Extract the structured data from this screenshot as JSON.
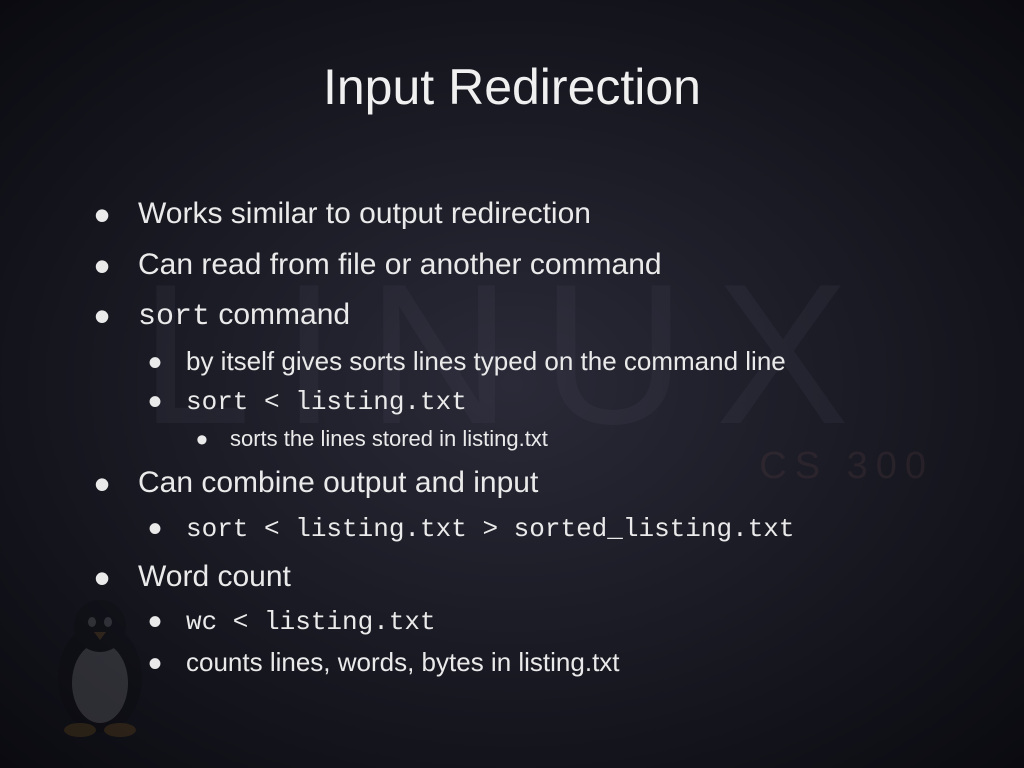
{
  "watermark": {
    "big": "LINUX",
    "course": "CS 300"
  },
  "title": "Input Redirection",
  "bullets": {
    "b1": "Works similar to output redirection",
    "b2": "Can read from file or another command",
    "b3_code": "sort",
    "b3_rest": " command",
    "b3a": "by itself gives sorts lines typed on the command line",
    "b3b": "sort < listing.txt",
    "b3b1": "sorts the lines stored in listing.txt",
    "b4": "Can combine output and input",
    "b4a": "sort < listing.txt > sorted_listing.txt",
    "b5": "Word count",
    "b5a": "wc < listing.txt",
    "b5b": "counts lines, words, bytes in listing.txt"
  }
}
